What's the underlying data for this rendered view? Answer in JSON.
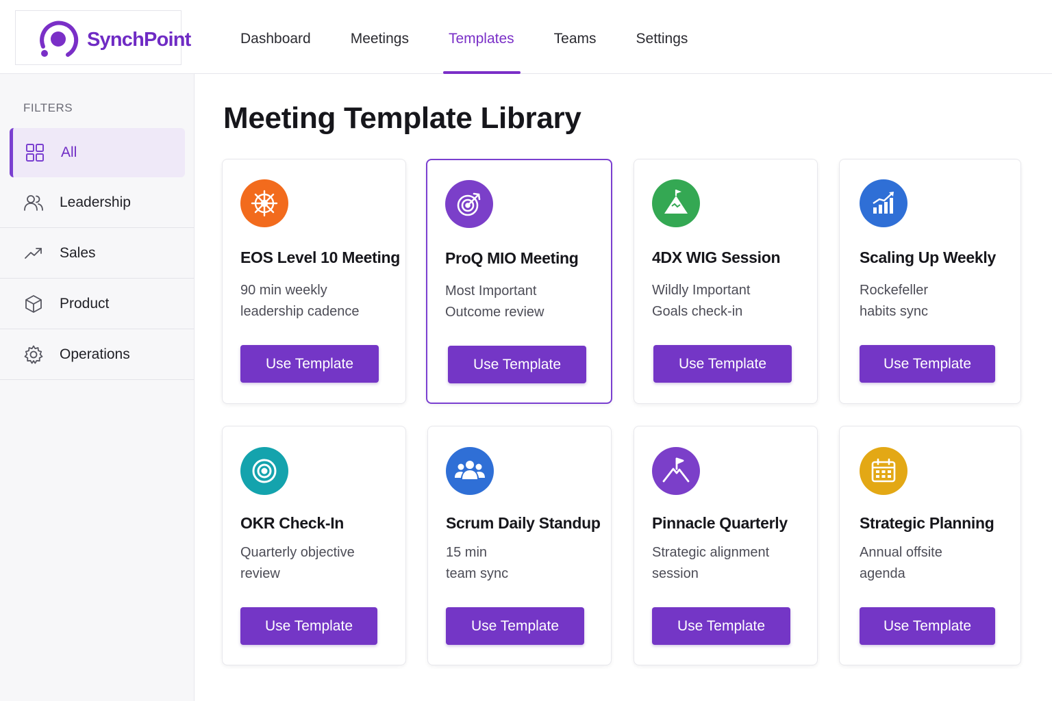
{
  "brand": {
    "name": "SynchPoint",
    "accent": "#7a2fc7"
  },
  "nav": [
    {
      "label": "Dashboard"
    },
    {
      "label": "Meetings"
    },
    {
      "label": "Templates",
      "active": true
    },
    {
      "label": "Teams"
    },
    {
      "label": "Settings"
    }
  ],
  "sidebar": {
    "heading": "FILTERS",
    "items": [
      {
        "label": "All",
        "icon": "grid-icon",
        "active": true
      },
      {
        "label": "Leadership",
        "icon": "users-icon"
      },
      {
        "label": "Sales",
        "icon": "trend-up-icon"
      },
      {
        "label": "Product",
        "icon": "cube-icon"
      },
      {
        "label": "Operations",
        "icon": "gear-icon"
      }
    ]
  },
  "main": {
    "title": "Meeting Template Library",
    "button_label": "Use Template",
    "cards": [
      {
        "title": "EOS Level 10 Meeting",
        "desc_line1": "90 min weekly",
        "desc_line2": "leadership cadence",
        "icon": "compass-wheel-icon",
        "color": "#f26b1d"
      },
      {
        "title": "ProQ MIO Meeting",
        "desc_line1": "Most Important",
        "desc_line2": "Outcome review",
        "icon": "target-arrow-icon",
        "color": "#7b3fc9",
        "selected": true
      },
      {
        "title": "4DX WIG Session",
        "desc_line1": "Wildly Important",
        "desc_line2": "Goals check-in",
        "icon": "mountain-flag-icon",
        "color": "#34a853"
      },
      {
        "title": "Scaling Up Weekly",
        "desc_line1": "Rockefeller",
        "desc_line2": "habits sync",
        "icon": "growth-chart-icon",
        "color": "#2f6fd6"
      },
      {
        "title": "OKR Check-In",
        "desc_line1": "Quarterly objective",
        "desc_line2": "review",
        "icon": "target-icon",
        "color": "#14a3ad"
      },
      {
        "title": "Scrum Daily Standup",
        "desc_line1": "15 min",
        "desc_line2": "team sync",
        "icon": "team-icon",
        "color": "#2f6fd6"
      },
      {
        "title": "Pinnacle Quarterly",
        "desc_line1": "Strategic alignment",
        "desc_line2": "session",
        "icon": "peak-flag-icon",
        "color": "#7b3fc9"
      },
      {
        "title": "Strategic Planning",
        "desc_line1": "Annual offsite",
        "desc_line2": "agenda",
        "icon": "calendar-icon",
        "color": "#e3a815"
      }
    ]
  }
}
